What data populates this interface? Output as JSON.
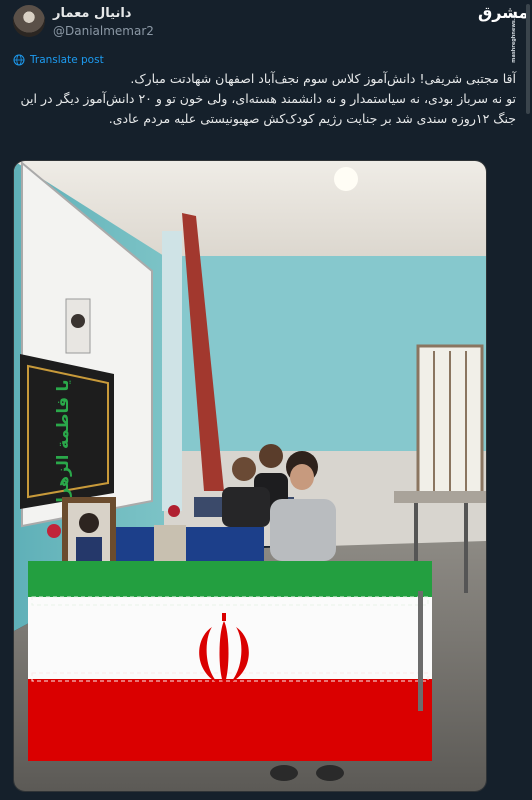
{
  "post": {
    "author_name": "دانیال معمار",
    "author_handle": "@Danialmemar2",
    "translate_label": "Translate post",
    "text_lines": [
      "آقا مجتبی شریفی! دانش‌آموز کلاس سوم نجف‌آباد اصفهان شهادتت مبارک.",
      "تو نه سرباز بودی، نه سیاستمدار و نه دانشمند هسته‌ای، ولی خون تو و ۲۰ دانش‌آموز دیگر در این جنگ ۱۲روزه سندی شد بر جنایت رژیم کودک‌کش صهیونیستی علیه مردم عادی."
    ]
  },
  "watermark": {
    "brand": "مشرق",
    "url": "mashreghnews.ir"
  },
  "photo": {
    "banner_text": "یا فاطمة الزهرا",
    "icons": {
      "avatar": "author-avatar",
      "translate": "globe-icon"
    }
  },
  "colors": {
    "background": "#15202b",
    "link": "#1d9bf0",
    "flag_green": "#239f40",
    "flag_red": "#da0000"
  }
}
